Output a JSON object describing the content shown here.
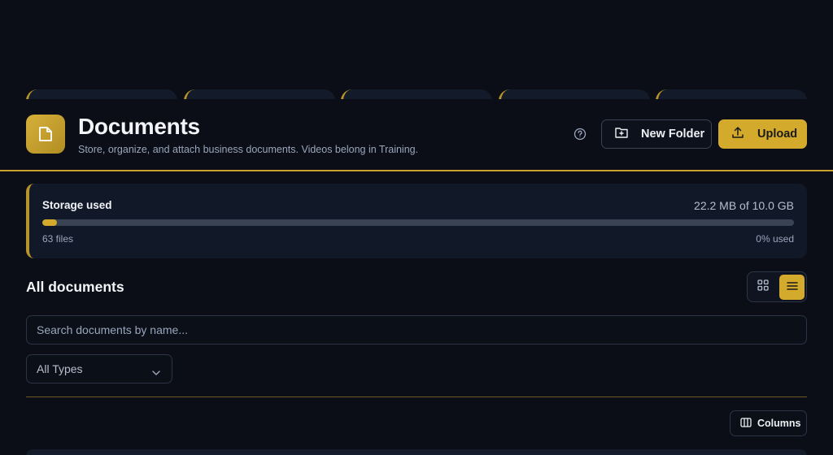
{
  "header": {
    "title": "Documents",
    "subtitle": "Store, organize, and attach business documents. Videos belong in Training.",
    "new_folder_label": "New Folder",
    "upload_label": "Upload",
    "icons": {
      "logo": "file-icon",
      "help": "help-circle-icon",
      "new_folder": "folder-plus-icon",
      "upload": "upload-icon"
    }
  },
  "storage": {
    "label": "Storage used",
    "amount": "22.2 MB of 10.0 GB",
    "files": "63 files",
    "percent_label": "0% used",
    "fill_fraction": 0.02
  },
  "documents": {
    "title": "All documents",
    "search_placeholder": "Search documents by name...",
    "type_filter": "All Types",
    "columns_label": "Columns",
    "view_mode": "list"
  },
  "colors": {
    "accent": "#d4aa2c",
    "background": "#0b0e16",
    "card": "#111827"
  }
}
